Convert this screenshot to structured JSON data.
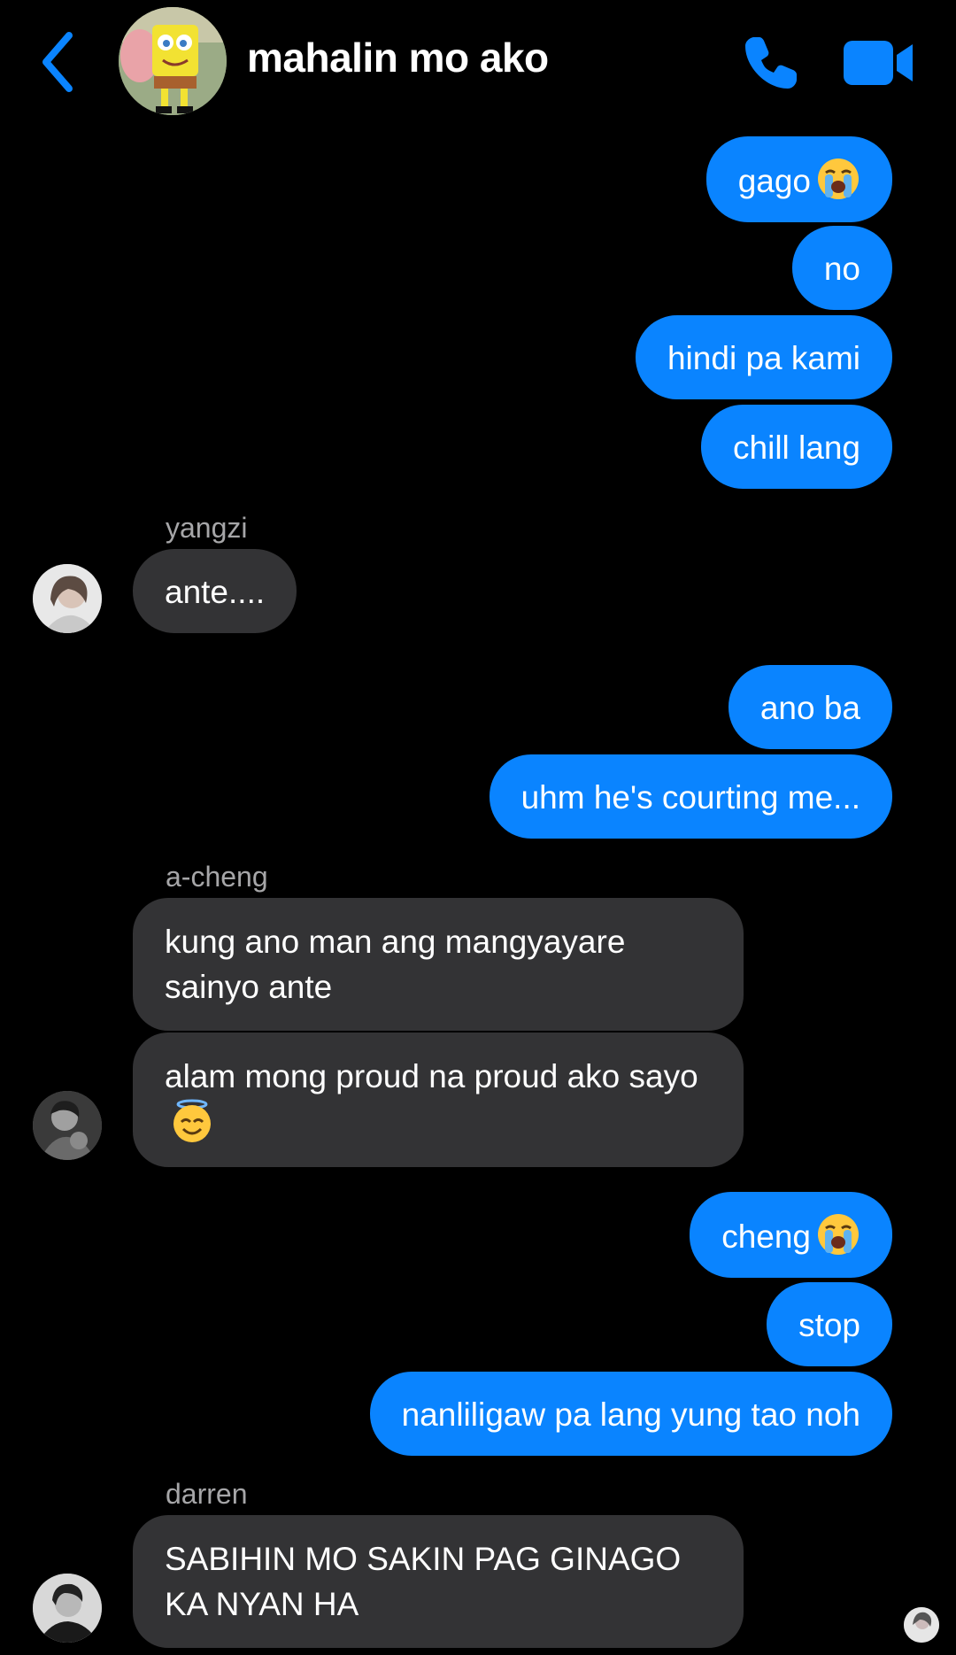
{
  "header": {
    "title": "mahalin mo ako",
    "back_icon": "chevron-left-icon",
    "call_icon": "phone-icon",
    "video_icon": "video-camera-icon",
    "accent_color": "#0a84ff"
  },
  "messages": [
    {
      "dir": "out",
      "text": "gago",
      "emoji": "loudly-crying-face"
    },
    {
      "dir": "out",
      "text": "no"
    },
    {
      "dir": "out",
      "text": "hindi pa kami"
    },
    {
      "dir": "out",
      "text": "chill lang"
    },
    {
      "dir": "in",
      "sender": "yangzi",
      "text": "ante...."
    },
    {
      "dir": "out",
      "text": "ano ba"
    },
    {
      "dir": "out",
      "text": "uhm he's courting me..."
    },
    {
      "dir": "in",
      "sender": "a-cheng",
      "text": "kung ano man ang mangyayare sainyo ante"
    },
    {
      "dir": "in",
      "text": "alam mong proud na proud ako sayo",
      "emoji": "smiling-face-with-halo"
    },
    {
      "dir": "out",
      "text": "cheng",
      "emoji": "loudly-crying-face"
    },
    {
      "dir": "out",
      "text": "stop"
    },
    {
      "dir": "out",
      "text": "nanliligaw pa lang yung tao noh"
    },
    {
      "dir": "in",
      "sender": "darren",
      "text": "SABIHIN MO SAKIN PAG GINAGO KA NYAN HA"
    }
  ],
  "senders": {
    "yangzi": "yangzi",
    "a_cheng": "a-cheng",
    "darren": "darren"
  },
  "colors": {
    "outgoing_bubble": "#0a84ff",
    "incoming_bubble": "#333335",
    "background": "#000000"
  }
}
